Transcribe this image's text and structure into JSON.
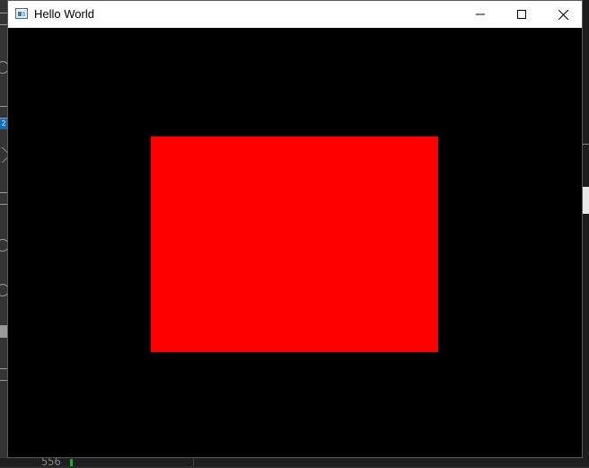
{
  "window": {
    "title": "Hello World",
    "client_background": "#000000"
  },
  "scene": {
    "rectangle_color": "#ff0000"
  },
  "background": {
    "line_number": "556",
    "badge": "2"
  },
  "icons": {
    "app": "window-app-icon",
    "minimize": "minimize-icon",
    "maximize": "maximize-icon",
    "close": "close-icon"
  }
}
